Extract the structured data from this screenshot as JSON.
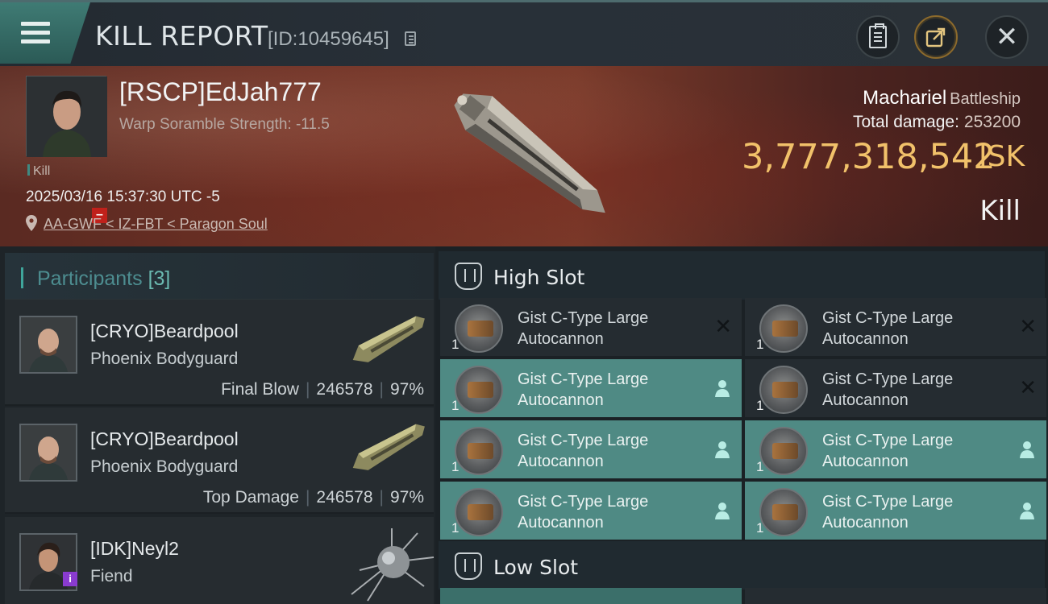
{
  "header": {
    "title": "KILL REPORT",
    "report_id": "[ID:10459645]",
    "icons": [
      "menu-icon",
      "copy-icon",
      "clipboard-icon",
      "share-icon",
      "close-icon"
    ],
    "close_glyph": "✕"
  },
  "victim": {
    "name": "[RSCP]EdJah777",
    "warp_scramble": "Warp Soramble Strength: -11.5",
    "tag": "Kill",
    "datetime": "2025/03/16 15:37:30 UTC -5",
    "location": "AA-GWF < IZ-FBT < Paragon Soul",
    "ship": "Machariel",
    "ship_class": "Battleship",
    "total_damage_label": "Total damage:",
    "total_damage": "253200",
    "isk_value": "3,777,318,542",
    "isk_unit": "ISK",
    "result": "Kill"
  },
  "participants": {
    "title": "Participants",
    "count": "[3]",
    "items": [
      {
        "name": "[CRYO]Beardpool",
        "ship": "Phoenix Bodyguard",
        "role": "Final Blow",
        "damage": "246578",
        "percent": "97%"
      },
      {
        "name": "[CRYO]Beardpool",
        "ship": "Phoenix Bodyguard",
        "role": "Top Damage",
        "damage": "246578",
        "percent": "97%"
      },
      {
        "name": "[IDK]Neyl2",
        "ship": "Fiend",
        "role": "",
        "damage": "",
        "percent": ""
      }
    ]
  },
  "slots": {
    "high_title": "High Slot",
    "low_title": "Low Slot",
    "high_modules": [
      {
        "qty": "1",
        "line1": "Gist C-Type Large",
        "line2": "Autocannon",
        "state": "destroyed"
      },
      {
        "qty": "1",
        "line1": "Gist C-Type Large",
        "line2": "Autocannon",
        "state": "destroyed"
      },
      {
        "qty": "1",
        "line1": "Gist C-Type Large",
        "line2": "Autocannon",
        "state": "dropped"
      },
      {
        "qty": "1",
        "line1": "Gist C-Type Large",
        "line2": "Autocannon",
        "state": "destroyed"
      },
      {
        "qty": "1",
        "line1": "Gist C-Type Large",
        "line2": "Autocannon",
        "state": "dropped"
      },
      {
        "qty": "1",
        "line1": "Gist C-Type Large",
        "line2": "Autocannon",
        "state": "dropped"
      },
      {
        "qty": "1",
        "line1": "Gist C-Type Large",
        "line2": "Autocannon",
        "state": "dropped"
      },
      {
        "qty": "1",
        "line1": "Gist C-Type Large",
        "line2": "Autocannon",
        "state": "dropped"
      }
    ]
  },
  "colors": {
    "accent": "#4f8a84",
    "isk": "#f1c16a",
    "loss_badge": "#c0211b"
  }
}
